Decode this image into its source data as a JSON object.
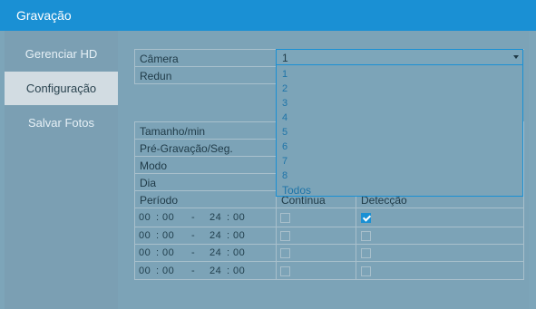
{
  "window": {
    "title": "Gravação"
  },
  "sidebar": {
    "items": [
      {
        "label": "Gerenciar HD"
      },
      {
        "label": "Configuração"
      },
      {
        "label": "Salvar Fotos"
      }
    ]
  },
  "form": {
    "camera_label": "Câmera",
    "camera_value": "1",
    "redun_label": "Redun",
    "size_label": "Tamanho/min",
    "prerecord_label": "Pré-Gravação/Seg.",
    "mode_label": "Modo",
    "day_label": "Dia",
    "period_label": "Período",
    "continuous_label": "Contínua",
    "detection_label": "Detecção"
  },
  "dropdown": {
    "options": [
      "1",
      "2",
      "3",
      "4",
      "5",
      "6",
      "7",
      "8",
      "Todos"
    ]
  },
  "periods": [
    {
      "start_h": "00",
      "start_m": "00",
      "sep": "-",
      "end_h": "24",
      "end_m": "00",
      "continuous": false,
      "detection": true
    },
    {
      "start_h": "00",
      "start_m": "00",
      "sep": "-",
      "end_h": "24",
      "end_m": "00",
      "continuous": false,
      "detection": false
    },
    {
      "start_h": "00",
      "start_m": "00",
      "sep": "-",
      "end_h": "24",
      "end_m": "00",
      "continuous": false,
      "detection": false
    },
    {
      "start_h": "00",
      "start_m": "00",
      "sep": "-",
      "end_h": "24",
      "end_m": "00",
      "continuous": false,
      "detection": false
    }
  ],
  "colors": {
    "accent": "#1a90d4",
    "panel": "#7ca3b7"
  }
}
